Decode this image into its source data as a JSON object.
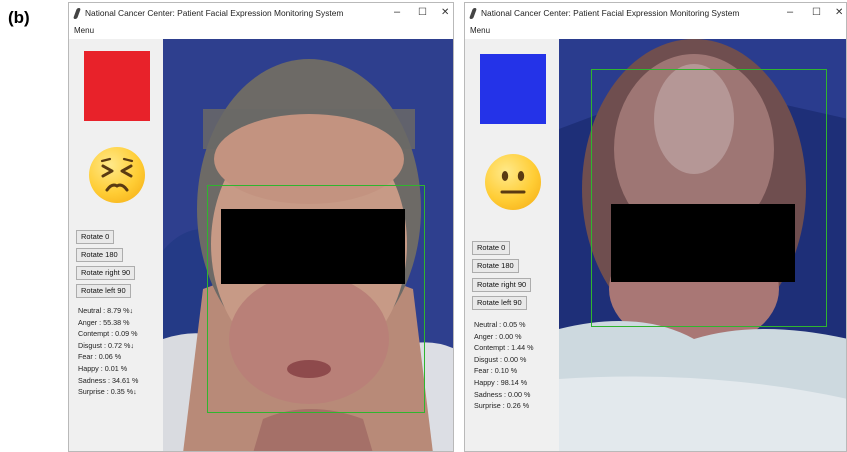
{
  "panel_label": "(b)",
  "windows": [
    {
      "title": "National Cancer Center: Patient Facial Expression Monitoring System",
      "controls": {
        "minimize": "–",
        "maximize": "☐",
        "close": "✕"
      },
      "menu": "Menu",
      "status_color": "#e8222a",
      "emoji": "persevering-face",
      "buttons": [
        "Rotate 0",
        "Rotate 180",
        "Rotate right 90",
        "Rotate left 90"
      ],
      "stats": [
        "Neutral : 8.79 %↓",
        "Anger : 55.38 %",
        "Contempt : 0.09 %",
        "Disgust : 0.72 %↓",
        "Fear : 0.06 %",
        "Happy : 0.01 %",
        "Sadness : 34.61 %",
        "Surprise : 0.35 %↓"
      ]
    },
    {
      "title": "National Cancer Center: Patient Facial Expression Monitoring System",
      "controls": {
        "minimize": "–",
        "maximize": "☐",
        "close": "✕"
      },
      "menu": "Menu",
      "status_color": "#2433e8",
      "emoji": "neutral-face",
      "buttons": [
        "Rotate 0",
        "Rotate 180",
        "Rotate right 90",
        "Rotate left 90"
      ],
      "stats": [
        "Neutral : 0.05 %",
        "Anger : 0.00 %",
        "Contempt : 1.44 %",
        "Disgust : 0.00 %",
        "Fear : 0.10 %",
        "Happy : 98.14 %",
        "Sadness : 0.00 %",
        "Surprise : 0.26 %"
      ]
    }
  ]
}
